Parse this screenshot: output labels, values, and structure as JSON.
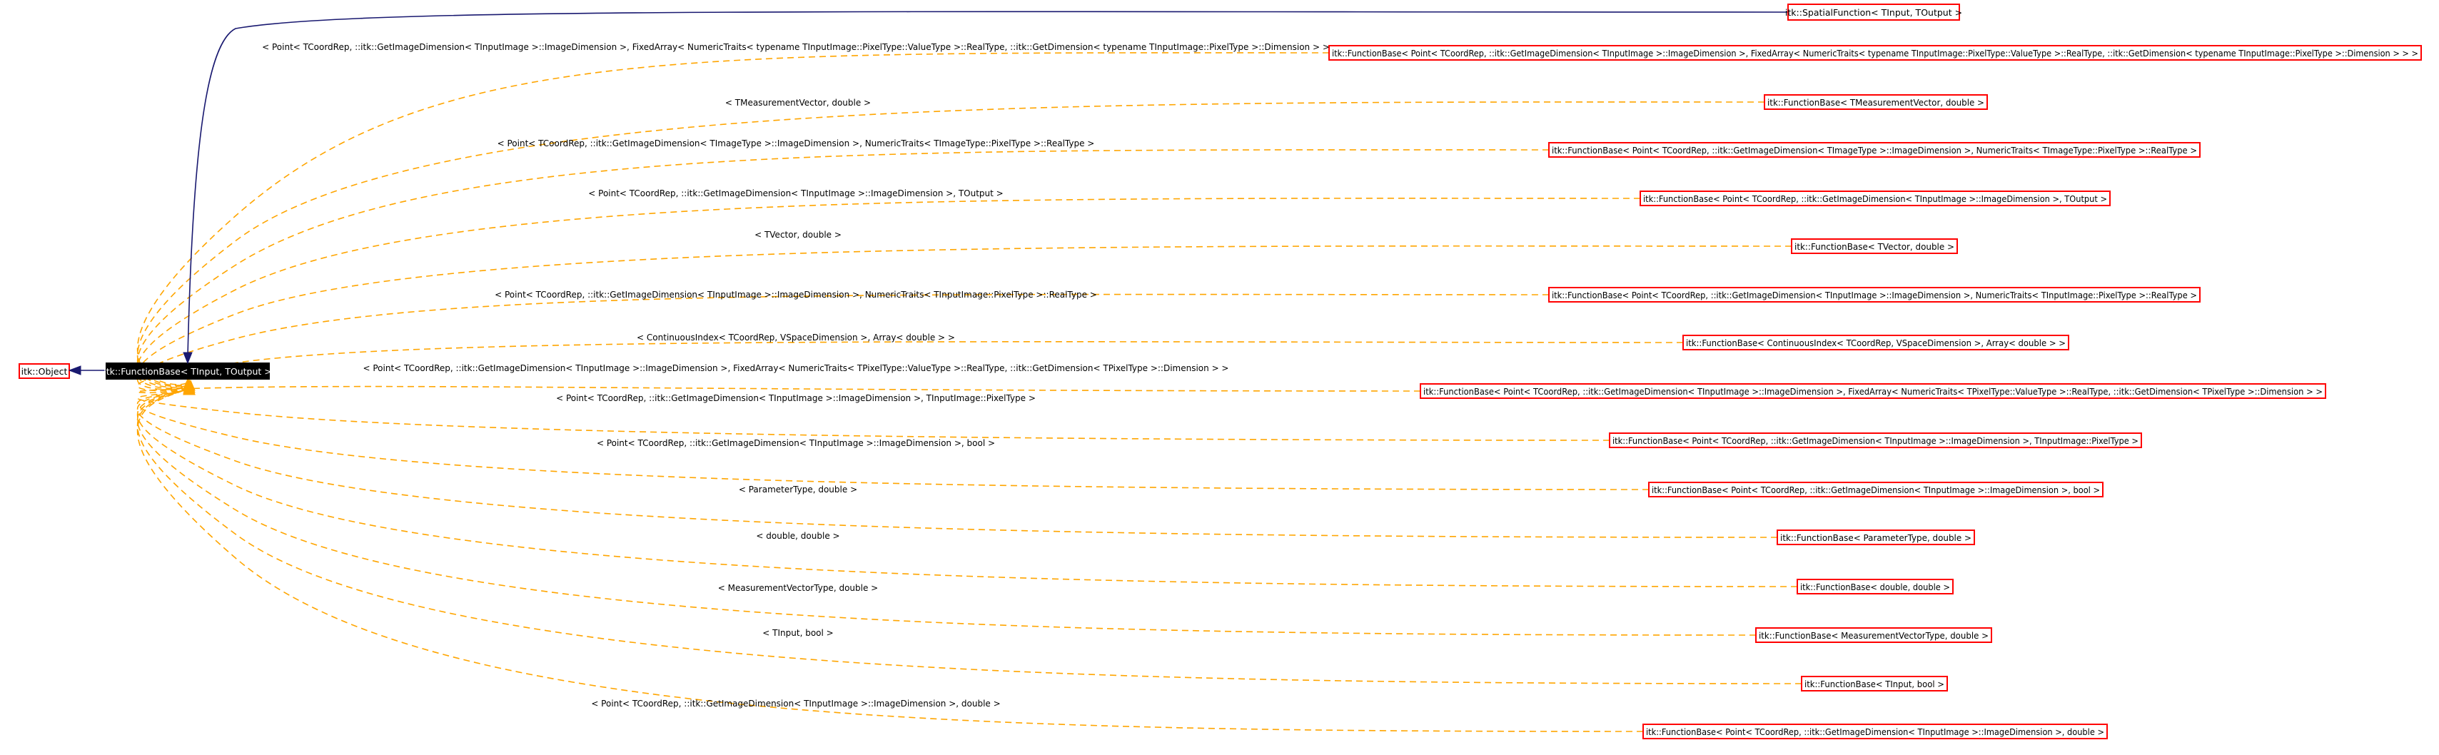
{
  "colors": {
    "node_border": "#ff0000",
    "selected_node_fill": "#000000",
    "selected_node_text": "#ffffff",
    "template_edge": "#ffa500",
    "inheritance_edge": "#191970"
  },
  "nodes": {
    "object": "itk::Object",
    "current": "itk::FunctionBase< TInput, TOutput >",
    "spatial": "itk::SpatialFunction< TInput, TOutput >"
  },
  "instantiations": [
    {
      "class": "itk::FunctionBase< Point< TCoordRep, ::itk::GetImageDimension< TInputImage >::ImageDimension >, FixedArray< NumericTraits< typename TInputImage::PixelType::ValueType >::RealType, ::itk::GetDimension< typename TInputImage::PixelType >::Dimension > > >",
      "label": "< Point< TCoordRep, ::itk::GetImageDimension< TInputImage >::ImageDimension >, FixedArray< NumericTraits< typename TInputImage::PixelType::ValueType >::RealType, ::itk::GetDimension< typename TInputImage::PixelType >::Dimension > >"
    },
    {
      "class": "itk::FunctionBase< TMeasurementVector, double >",
      "label": "< TMeasurementVector, double >"
    },
    {
      "class": "itk::FunctionBase< Point< TCoordRep, ::itk::GetImageDimension< TImageType >::ImageDimension >, NumericTraits< TImageType::PixelType >::RealType >",
      "label": "< Point< TCoordRep, ::itk::GetImageDimension< TImageType >::ImageDimension >, NumericTraits< TImageType::PixelType >::RealType >"
    },
    {
      "class": "itk::FunctionBase< Point< TCoordRep, ::itk::GetImageDimension< TInputImage >::ImageDimension >, TOutput >",
      "label": "< Point< TCoordRep, ::itk::GetImageDimension< TInputImage >::ImageDimension >, TOutput >"
    },
    {
      "class": "itk::FunctionBase< TVector, double >",
      "label": "< TVector, double >"
    },
    {
      "class": "itk::FunctionBase< Point< TCoordRep, ::itk::GetImageDimension< TInputImage >::ImageDimension >, NumericTraits< TInputImage::PixelType >::RealType >",
      "label": "< Point< TCoordRep, ::itk::GetImageDimension< TInputImage >::ImageDimension >, NumericTraits< TInputImage::PixelType >::RealType >"
    },
    {
      "class": "itk::FunctionBase< ContinuousIndex< TCoordRep, VSpaceDimension >, Array< double > >",
      "label": "< ContinuousIndex< TCoordRep, VSpaceDimension >, Array< double > >"
    },
    {
      "class": "itk::FunctionBase< Point< TCoordRep, ::itk::GetImageDimension< TInputImage >::ImageDimension >, FixedArray< NumericTraits< TPixelType::ValueType >::RealType, ::itk::GetDimension< TPixelType >::Dimension > >",
      "label": "< Point< TCoordRep, ::itk::GetImageDimension< TInputImage >::ImageDimension >, FixedArray< NumericTraits< TPixelType::ValueType >::RealType, ::itk::GetDimension< TPixelType >::Dimension > >"
    },
    {
      "class": "itk::FunctionBase< Point< TCoordRep, ::itk::GetImageDimension< TInputImage >::ImageDimension >, TInputImage::PixelType >",
      "label": "< Point< TCoordRep, ::itk::GetImageDimension< TInputImage >::ImageDimension >, TInputImage::PixelType >"
    },
    {
      "class": "itk::FunctionBase< Point< TCoordRep, ::itk::GetImageDimension< TInputImage >::ImageDimension >, bool >",
      "label": "< Point< TCoordRep, ::itk::GetImageDimension< TInputImage >::ImageDimension >, bool >"
    },
    {
      "class": "itk::FunctionBase< ParameterType, double >",
      "label": "< ParameterType, double >"
    },
    {
      "class": "itk::FunctionBase< double, double >",
      "label": "< double, double >"
    },
    {
      "class": "itk::FunctionBase< MeasurementVectorType, double >",
      "label": "< MeasurementVectorType, double >"
    },
    {
      "class": "itk::FunctionBase< TInput, bool >",
      "label": "< TInput, bool >"
    },
    {
      "class": "itk::FunctionBase< Point< TCoordRep, ::itk::GetImageDimension< TInputImage >::ImageDimension >, double >",
      "label": "< Point< TCoordRep, ::itk::GetImageDimension< TInputImage >::ImageDimension >, double >"
    }
  ]
}
